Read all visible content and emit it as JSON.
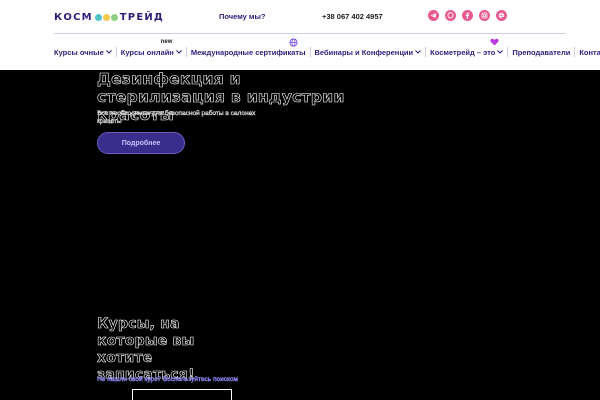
{
  "header": {
    "logo_left": "КОСМ",
    "logo_right": "ТРЕЙД",
    "logo_dot_colors": [
      "#4fc3c8",
      "#f2c94c",
      "#8ed081"
    ],
    "why_link": "Почему мы?",
    "phone": "+38 067 402 4957",
    "socials": [
      {
        "icon": "telegram-icon",
        "color": "#e85a8f"
      },
      {
        "icon": "viber-icon",
        "color": "#e85a8f"
      },
      {
        "icon": "facebook-icon",
        "color": "#e85a8f"
      },
      {
        "icon": "instagram-icon",
        "color": "#e85a8f"
      },
      {
        "icon": "email-icon",
        "color": "#e85a8f"
      }
    ]
  },
  "nav": {
    "items": [
      {
        "label": "Курсы очные",
        "dropdown": true
      },
      {
        "label": "Курсы онлайн",
        "dropdown": true,
        "badge": "new"
      },
      {
        "label": "Международные сертификаты",
        "dropdown": false,
        "icon": "globe-icon"
      },
      {
        "label": "Вебинары и Конференции",
        "dropdown": true
      },
      {
        "label": "Косметрейд – это",
        "dropdown": true,
        "icon": "heart-icon"
      },
      {
        "label": "Преподаватели",
        "dropdown": false
      },
      {
        "label": "Контакты",
        "dropdown": false
      }
    ]
  },
  "hero": {
    "title": "Дезинфекция и стерилизация в индустрии красоты",
    "subtitle": "Все необходимое для безопасной работы в салонах красоты",
    "button": "Подробнее"
  },
  "courses": {
    "title": "Курсы, на которые вы хотите записаться!",
    "subtitle": "Не нашли свой курс? Воспользуйтесь поиском"
  },
  "colors": {
    "brand": "#2c1f7a",
    "accent_pink": "#e85a8f",
    "button_bg": "#3a2e8c"
  }
}
